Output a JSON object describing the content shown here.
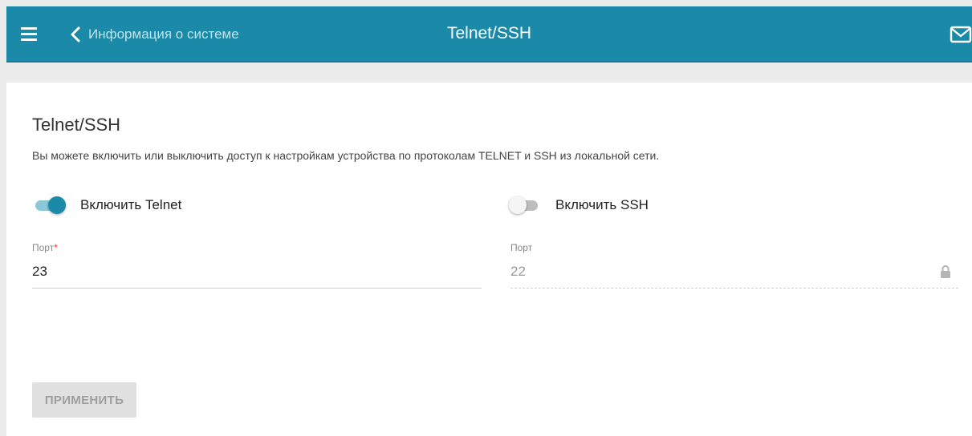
{
  "header": {
    "back_label": "Информация о системе",
    "title": "Telnet/SSH",
    "bg_color": "#1a8aa8"
  },
  "icons": {
    "menu": "hamburger-menu-icon",
    "back": "chevron-left-icon",
    "mail": "mail-icon",
    "lock": "lock-icon"
  },
  "main": {
    "title": "Telnet/SSH",
    "description": "Вы можете включить или выключить доступ к настройкам устройства по протоколам TELNET и SSH из локальной сети.",
    "telnet": {
      "toggle_label": "Включить Telnet",
      "enabled": true,
      "port_label": "Порт",
      "required_mark": "*",
      "port_value": "23"
    },
    "ssh": {
      "toggle_label": "Включить SSH",
      "enabled": false,
      "port_label": "Порт",
      "port_value": "22",
      "locked": true
    },
    "apply_label": "ПРИМЕНИТЬ"
  }
}
